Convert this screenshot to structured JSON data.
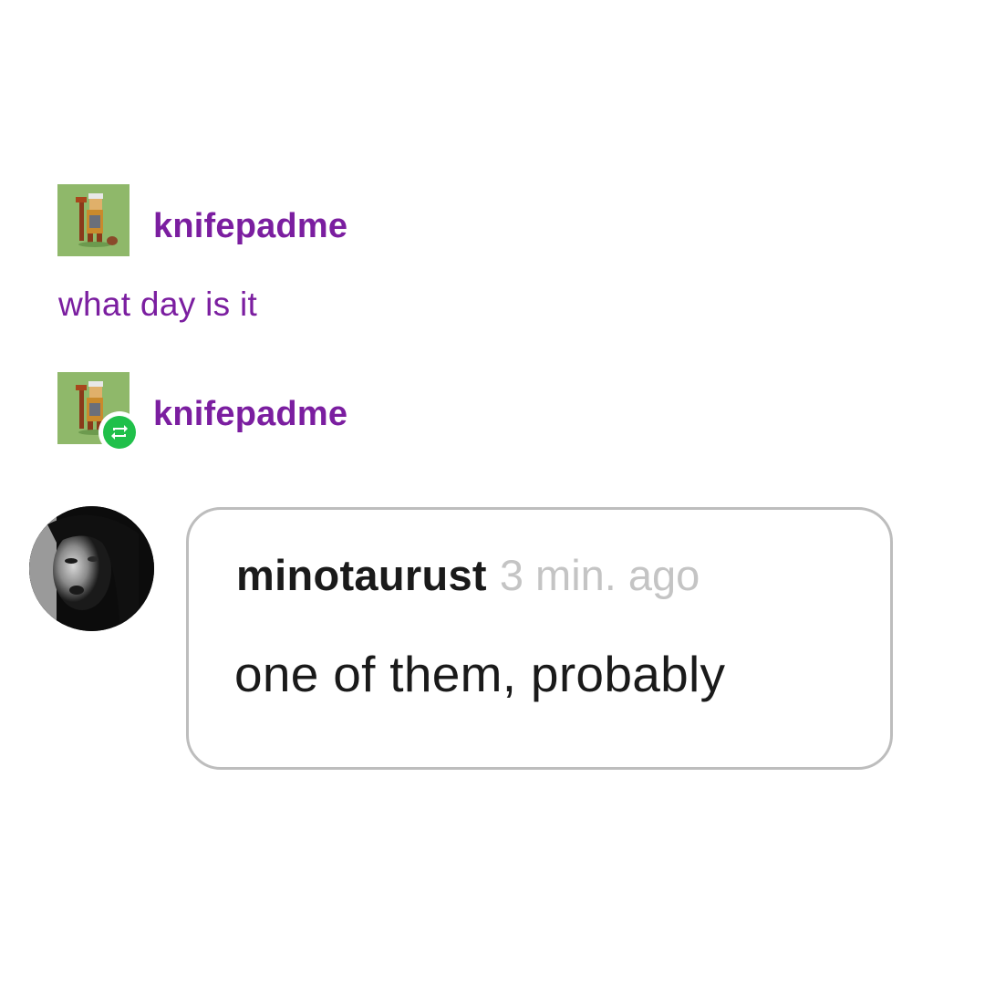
{
  "posts": [
    {
      "username": "knifepadme",
      "text": "what day is it"
    },
    {
      "username": "knifepadme",
      "reblog": true
    }
  ],
  "comment": {
    "author": "minotaurust",
    "time": "3 min. ago",
    "body": "one of them, probably"
  },
  "icons": {
    "avatar_square": "pixel-art-avatar-icon",
    "reblog": "reblog-icon",
    "avatar_round": "portrait-avatar-icon"
  },
  "colors": {
    "username": "#7b1ea0",
    "reblog_badge": "#20c04a",
    "bubble_border": "#bdbdbd",
    "timestamp": "#c4c4c4"
  }
}
